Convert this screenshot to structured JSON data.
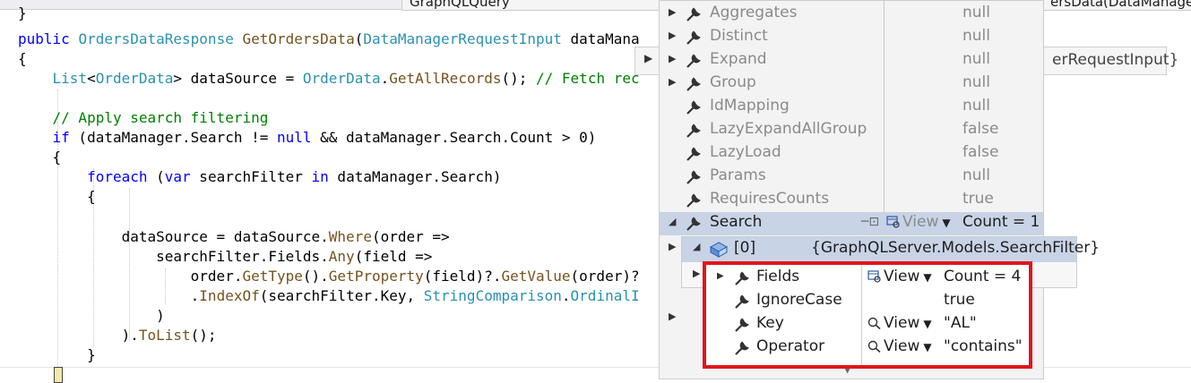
{
  "tabs": [
    "GraphQLQuery",
    "ersData(DataManager"
  ],
  "code_lines": [
    "}",
    "public OrdersDataResponse GetOrdersData(DataManagerRequestInput dataMana",
    "{",
    "    List<OrderData> dataSource = OrderData.GetAllRecords(); // Fetch rec",
    "",
    "    // Apply search filtering",
    "    if (dataManager.Search != null && dataManager.Search.Count > 0)",
    "    {",
    "        foreach (var searchFilter in dataManager.Search)",
    "        {",
    "",
    "            dataSource = dataSource.Where(order =>",
    "                searchFilter.Fields.Any(field =>",
    "                    order.GetType().GetProperty(field)?.GetValue(order)?",
    "                    .IndexOf(searchFilter.Key, StringComparison.OrdinalI",
    "                )",
    "            ).ToList();",
    "        }"
  ],
  "hover_type_tip": "erRequestInput}",
  "datatip": {
    "rows": [
      {
        "name": "Aggregates",
        "value": "null"
      },
      {
        "name": "Distinct",
        "value": "null"
      },
      {
        "name": "Expand",
        "value": "null"
      },
      {
        "name": "Group",
        "value": "null"
      },
      {
        "name": "IdMapping",
        "value": "null"
      },
      {
        "name": "LazyExpandAllGroup",
        "value": "false"
      },
      {
        "name": "LazyLoad",
        "value": "false"
      },
      {
        "name": "Params",
        "value": "null"
      },
      {
        "name": "RequiresCounts",
        "value": "true"
      }
    ],
    "search": {
      "name": "Search",
      "view": "View",
      "value": "Count = 1"
    },
    "search_item": {
      "name": "[0]",
      "value": "{GraphQLServer.Models.SearchFilter}"
    },
    "filter_fields": [
      {
        "name": "Fields",
        "view": "View",
        "value": "Count = 4",
        "icon": "table-view-icon",
        "expandable": true
      },
      {
        "name": "IgnoreCase",
        "view": "",
        "value": "true",
        "icon": "",
        "expandable": false
      },
      {
        "name": "Key",
        "view": "View",
        "value": "\"AL\"",
        "icon": "magnifier-icon",
        "expandable": false
      },
      {
        "name": "Operator",
        "view": "View",
        "value": "\"contains\"",
        "icon": "magnifier-icon",
        "expandable": false
      }
    ]
  },
  "colors": {
    "highlight_border": "#e0161b",
    "selected_row": "#c8d3e6",
    "keyword": "#0000ff",
    "type": "#2b91af",
    "comment": "#008000"
  }
}
